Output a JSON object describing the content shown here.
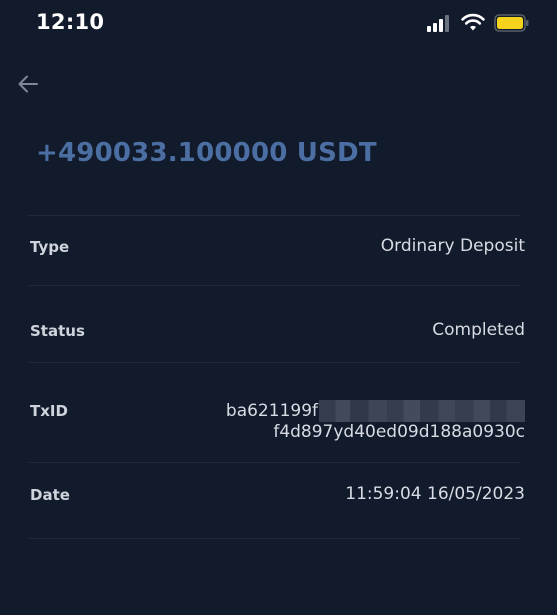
{
  "status_bar": {
    "time": "12:10",
    "icons": [
      "signal-icon",
      "wifi-icon",
      "battery-icon"
    ],
    "battery_color": "#f5d21b"
  },
  "header": {
    "back_icon": "back-arrow-icon"
  },
  "transaction": {
    "amount": "+490033.100000 USDT",
    "amount_color": "#4c6fa3",
    "rows": [
      {
        "label": "Type",
        "value": "Ordinary Deposit"
      },
      {
        "label": "Status",
        "value": "Completed"
      },
      {
        "label": "TxID",
        "value_start": "ba621199f",
        "value_end": "f4d897yd40ed09d188a0930c"
      },
      {
        "label": "Date",
        "value": "11:59:04 16/05/2023"
      }
    ]
  }
}
